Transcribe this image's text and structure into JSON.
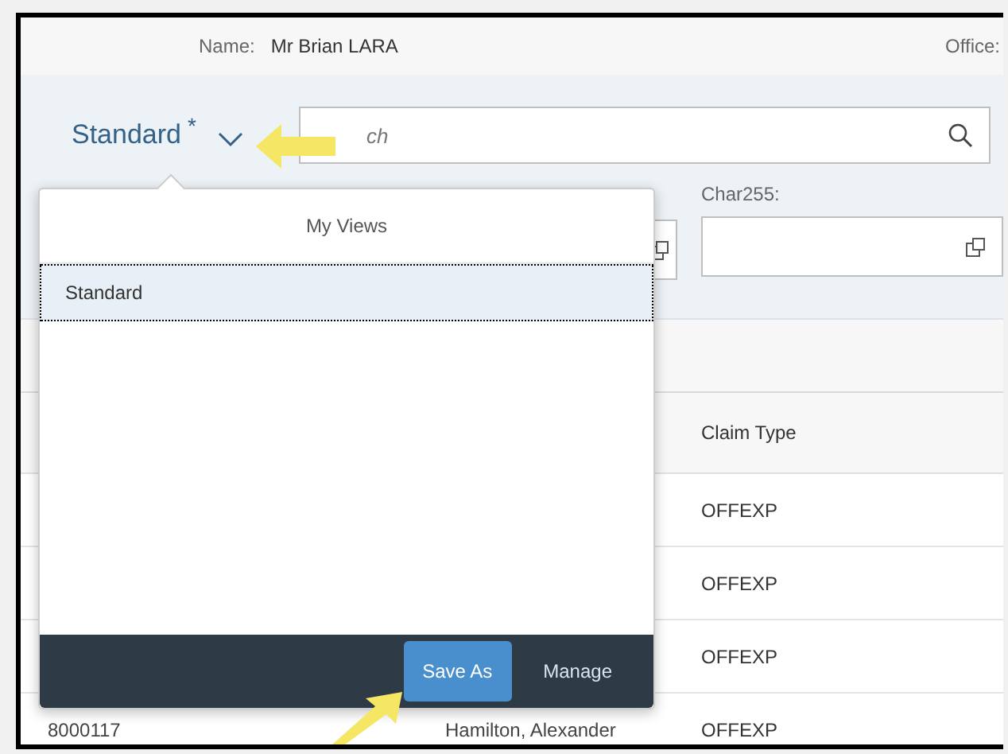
{
  "header": {
    "name_label": "Name:",
    "name_value": "Mr Brian LARA",
    "office_label": "Office:"
  },
  "filter_bar": {
    "variant": {
      "title": "Standard",
      "modified_mark": "*"
    },
    "search": {
      "placeholder": "ch"
    },
    "fields": [
      {
        "label": "Char255:"
      }
    ]
  },
  "table": {
    "columns": [
      "Claim Type"
    ],
    "rows": [
      {
        "claim_type": "OFFEXP"
      },
      {
        "claim_type": "OFFEXP"
      },
      {
        "claim_type": "OFFEXP"
      },
      {
        "id": "8000117",
        "name": "Hamilton, Alexander",
        "claim_type": "OFFEXP"
      }
    ]
  },
  "views_popover": {
    "title": "My Views",
    "items": [
      {
        "label": "Standard",
        "selected": true
      }
    ],
    "buttons": [
      {
        "label": "Save As",
        "kind": "emphasized"
      },
      {
        "label": "Manage",
        "kind": "plain"
      }
    ]
  }
}
